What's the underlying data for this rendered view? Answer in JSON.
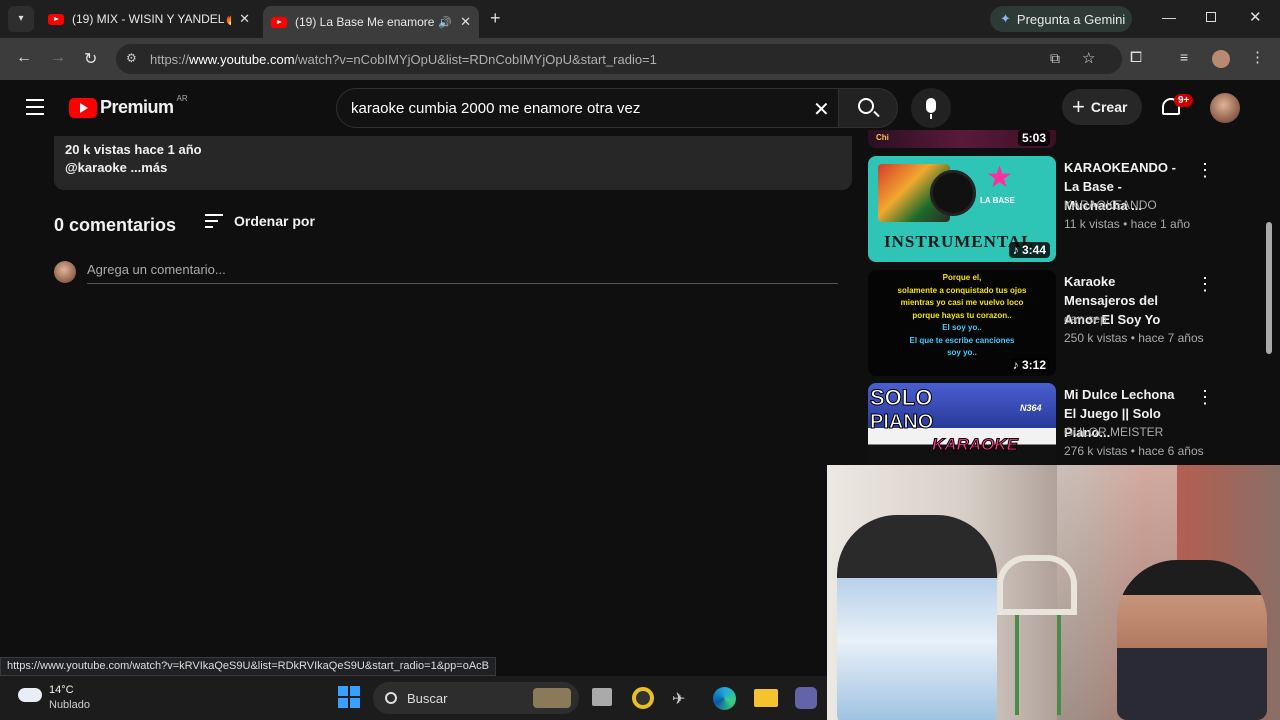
{
  "browser": {
    "tabs": [
      {
        "title": "(19) MIX - WISIN Y YANDEL🔥("
      },
      {
        "title": "(19) La Base Me enamore o"
      }
    ],
    "gemini_label": "Pregunta a Gemini",
    "url_pre": "https://",
    "url_host": "www.youtube.com",
    "url_path": "/watch?v=nCobIMYjOpU&list=RDnCobIMYjOpU&start_radio=1",
    "status_url": "https://www.youtube.com/watch?v=kRVIkaQeS9U&list=RDkRVIkaQeS9U&start_radio=1&pp=oAcB"
  },
  "youtube": {
    "logo": "Premium",
    "country": "AR",
    "search_value": "karaoke cumbia 2000 me enamore otra vez",
    "create_label": "Crear",
    "notif_badge": "9+"
  },
  "description": {
    "stats": "20 k vistas  hace 1 año",
    "line2": "@karaoke ...más"
  },
  "comments": {
    "count_label": "0 comentarios",
    "sort_label": "Ordenar por",
    "placeholder": "Agrega un comentario..."
  },
  "sidebar": {
    "top_partial_duration": "5:03",
    "items": [
      {
        "title": "KARAOKEANDO - La Base - Muchacha ...",
        "channel": "KARAOKEANDO",
        "meta": "11 k vistas • hace 1 año",
        "duration": "3:44",
        "thumb_text": "INSTRUMENTAL"
      },
      {
        "title": "Karaoke Mensajeros del Amor El Soy Yo",
        "channel": "dan sep",
        "meta": "250 k vistas • hace 7 años",
        "duration": "3:12",
        "lyrics": [
          "Porque el,",
          "solamente a conquistado tus ojos",
          "mientras yo casi me vuelvo loco",
          "porque hayas tu corazon..",
          "El soy yo..",
          "El que te escribe canciones",
          "soy yo.."
        ]
      },
      {
        "title": "Mi Dulce Lechona El Juego || Solo Piano...",
        "channel": "GULOR MEISTER",
        "meta": "276 k vistas • hace 6 años",
        "thumb_text1": "SOLO",
        "thumb_text2": "PIANO",
        "thumb_text3": "KARAOKE",
        "thumb_badge": "N364"
      }
    ]
  },
  "taskbar": {
    "temp": "14°C",
    "weather": "Nublado",
    "search_label": "Buscar"
  },
  "colors": {
    "yt_red": "#ff0000",
    "bg": "#0f0f0f",
    "thumb_cyan": "#2ec4b6"
  }
}
